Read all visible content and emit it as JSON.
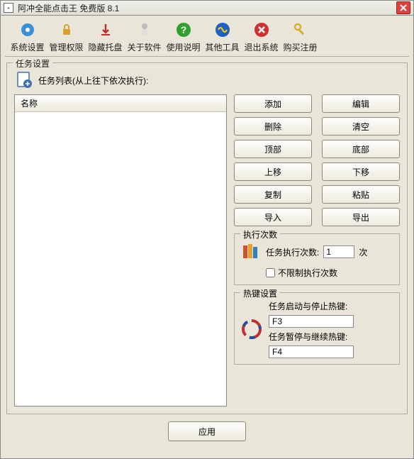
{
  "window": {
    "title": "阿冲全能点击王 免费版 8.1"
  },
  "toolbar": [
    {
      "id": "sys-settings",
      "label": "系统设置",
      "color": "#3890d8"
    },
    {
      "id": "perm",
      "label": "管理权限",
      "color": "#d8a030"
    },
    {
      "id": "hide-tray",
      "label": "隐藏托盘",
      "color": "#c03030"
    },
    {
      "id": "about",
      "label": "关于软件",
      "color": "#909090"
    },
    {
      "id": "help",
      "label": "使用说明",
      "color": "#30a030"
    },
    {
      "id": "other",
      "label": "其他工具",
      "color": "#2060c0"
    },
    {
      "id": "exit",
      "label": "退出系统",
      "color": "#d03030"
    },
    {
      "id": "register",
      "label": "购买注册",
      "color": "#d8b030"
    }
  ],
  "task_settings": {
    "legend": "任务设置",
    "list_label": "任务列表(从上往下依次执行):",
    "column_header": "名称"
  },
  "buttons": {
    "add": "添加",
    "edit": "编辑",
    "delete": "删除",
    "clear": "清空",
    "top": "顶部",
    "bottom": "底部",
    "up": "上移",
    "down": "下移",
    "copy": "复制",
    "paste": "粘贴",
    "import": "导入",
    "export": "导出"
  },
  "exec": {
    "legend": "执行次数",
    "label": "任务执行次数:",
    "value": "1",
    "suffix": "次",
    "unlimited_label": "不限制执行次数",
    "unlimited_checked": false
  },
  "hotkey": {
    "legend": "热键设置",
    "start_label": "任务启动与停止热键:",
    "start_value": "F3",
    "pause_label": "任务暂停与继续热键:",
    "pause_value": "F4"
  },
  "apply": {
    "label": "应用"
  }
}
